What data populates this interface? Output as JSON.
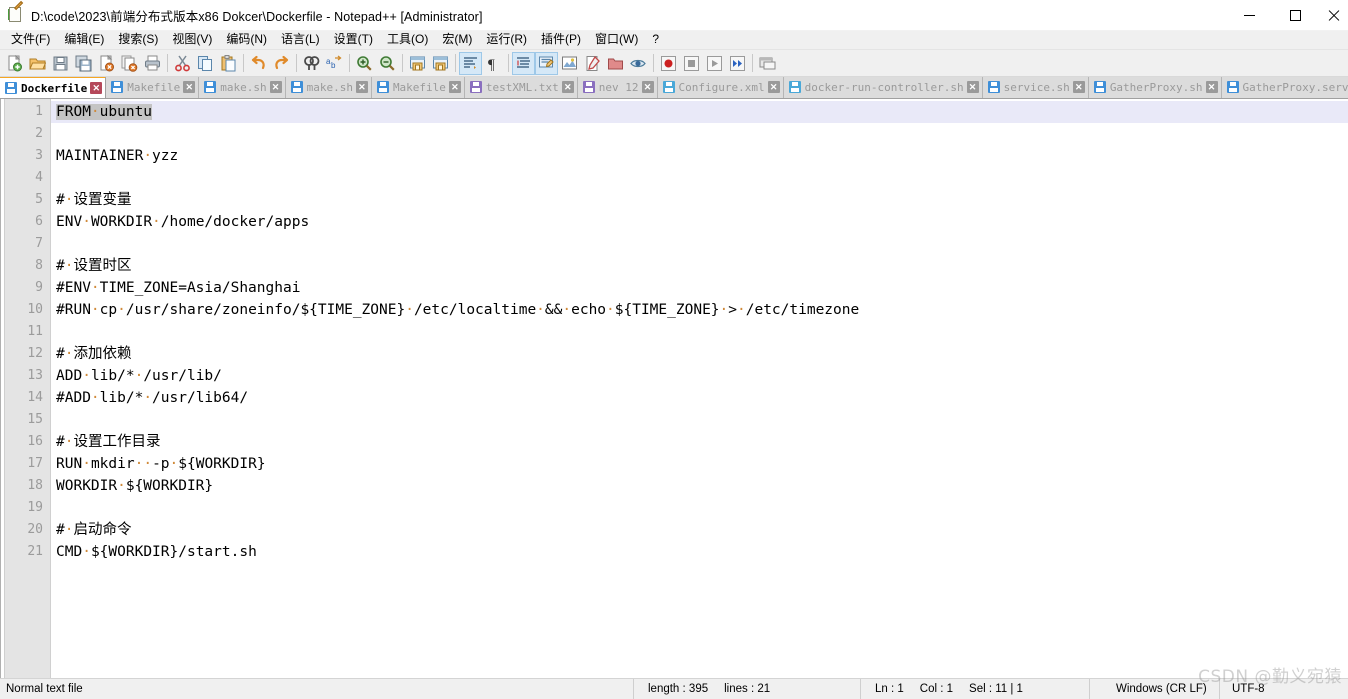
{
  "window": {
    "title": "D:\\code\\2023\\前端分布式版本x86 Dokcer\\Dockerfile - Notepad++ [Administrator]",
    "icon": "notepadpp-document-icon",
    "controls": {
      "minimize": "–",
      "maximize": "□",
      "close": "✕"
    }
  },
  "menu": {
    "items": [
      {
        "label": "文件(F)",
        "name": "menu-file"
      },
      {
        "label": "编辑(E)",
        "name": "menu-edit"
      },
      {
        "label": "搜索(S)",
        "name": "menu-search"
      },
      {
        "label": "视图(V)",
        "name": "menu-view"
      },
      {
        "label": "编码(N)",
        "name": "menu-encoding"
      },
      {
        "label": "语言(L)",
        "name": "menu-language"
      },
      {
        "label": "设置(T)",
        "name": "menu-settings"
      },
      {
        "label": "工具(O)",
        "name": "menu-tools"
      },
      {
        "label": "宏(M)",
        "name": "menu-macro"
      },
      {
        "label": "运行(R)",
        "name": "menu-run"
      },
      {
        "label": "插件(P)",
        "name": "menu-plugins"
      },
      {
        "label": "窗口(W)",
        "name": "menu-window"
      },
      {
        "label": "?",
        "name": "menu-help"
      }
    ]
  },
  "toolbar": {
    "buttons": [
      "new-file-icon",
      "open-file-icon",
      "save-icon",
      "save-all-icon",
      "close-file-icon",
      "close-all-icon",
      "print-icon",
      "sep",
      "cut-icon",
      "copy-icon",
      "paste-icon",
      "sep",
      "undo-icon",
      "redo-icon",
      "sep",
      "find-icon",
      "replace-icon",
      "sep",
      "zoom-in-icon",
      "zoom-out-icon",
      "sep",
      "sync-vertical-scroll-icon",
      "sync-horizontal-scroll-icon",
      "sep",
      "word-wrap-icon",
      "show-all-chars-icon",
      "sep",
      "indent-guide-icon",
      "user-defined-language-icon",
      "document-map-icon",
      "function-list-icon",
      "folder-workspace-icon",
      "monitoring-icon",
      "sep",
      "macro-record-icon",
      "macro-stop-icon",
      "macro-play-icon",
      "macro-run-multiple-icon",
      "sep",
      "run-panel-icon"
    ]
  },
  "tabs": [
    {
      "label": "Dockerfile",
      "icon": "save-icon-blue",
      "active": true
    },
    {
      "label": "Makefile",
      "icon": "save-icon-blue",
      "active": false
    },
    {
      "label": "make.sh",
      "icon": "save-icon-blue",
      "active": false
    },
    {
      "label": "make.sh",
      "icon": "save-icon-blue",
      "active": false
    },
    {
      "label": "Makefile",
      "icon": "save-icon-blue",
      "active": false
    },
    {
      "label": "testXML.txt",
      "icon": "save-icon-purple",
      "active": false
    },
    {
      "label": "nev 12",
      "icon": "save-icon-purple",
      "active": false
    },
    {
      "label": "Configure.xml",
      "icon": "save-icon-cyan",
      "active": false
    },
    {
      "label": "docker-run-controller.sh",
      "icon": "save-icon-cyan",
      "active": false
    },
    {
      "label": "service.sh",
      "icon": "save-icon-blue",
      "active": false
    },
    {
      "label": "GatherProxy.sh",
      "icon": "save-icon-blue",
      "active": false
    },
    {
      "label": "GatherProxy.service",
      "icon": "save-icon-blue",
      "active": false
    }
  ],
  "editor": {
    "lines": [
      {
        "n": "1",
        "text": "FROM·ubuntu",
        "selected": true,
        "current": true
      },
      {
        "n": "2",
        "text": ""
      },
      {
        "n": "3",
        "text": "MAINTAINER·yzz"
      },
      {
        "n": "4",
        "text": ""
      },
      {
        "n": "5",
        "text": "#·设置变量"
      },
      {
        "n": "6",
        "text": "ENV·WORKDIR·/home/docker/apps"
      },
      {
        "n": "7",
        "text": ""
      },
      {
        "n": "8",
        "text": "#·设置时区"
      },
      {
        "n": "9",
        "text": "#ENV·TIME_ZONE=Asia/Shanghai"
      },
      {
        "n": "10",
        "text": "#RUN·cp·/usr/share/zoneinfo/${TIME_ZONE}·/etc/localtime·&&·echo·${TIME_ZONE}·>·/etc/timezone"
      },
      {
        "n": "11",
        "text": ""
      },
      {
        "n": "12",
        "text": "#·添加依赖"
      },
      {
        "n": "13",
        "text": "ADD·lib/*·/usr/lib/"
      },
      {
        "n": "14",
        "text": "#ADD·lib/*·/usr/lib64/"
      },
      {
        "n": "15",
        "text": ""
      },
      {
        "n": "16",
        "text": "#·设置工作目录"
      },
      {
        "n": "17",
        "text": "RUN·mkdir··-p·${WORKDIR}"
      },
      {
        "n": "18",
        "text": "WORKDIR·${WORKDIR}"
      },
      {
        "n": "19",
        "text": ""
      },
      {
        "n": "20",
        "text": "#·启动命令"
      },
      {
        "n": "21",
        "text": "CMD·${WORKDIR}/start.sh"
      }
    ]
  },
  "statusbar": {
    "file_type": "Normal text file",
    "length_label": "length : 395",
    "lines_label": "lines : 21",
    "ln": "Ln : 1",
    "col": "Col : 1",
    "sel": "Sel : 11 | 1",
    "eol": "Windows (CR LF)",
    "encoding": "UTF-8"
  },
  "watermark": "CSDN @勤义宛猿"
}
